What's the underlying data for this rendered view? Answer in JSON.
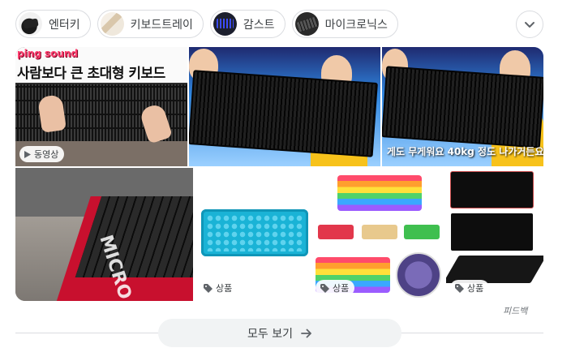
{
  "chips": [
    {
      "label": "엔터키",
      "thumb_icon": "keyboard-black-thumb"
    },
    {
      "label": "키보드트레이",
      "thumb_icon": "keyboard-tray-thumb"
    },
    {
      "label": "감스트",
      "thumb_icon": "keyboard-rgb-thumb"
    },
    {
      "label": "마이크로닉스",
      "thumb_icon": "micronics-keyboard-thumb"
    }
  ],
  "tiles": {
    "t1": {
      "overlay_pink": "ping sound",
      "overlay_big": "사람보다 큰 초대형 키보드",
      "badge": "동영상"
    },
    "t3": {
      "subtitle": "게도 무게워요 40kg 정도 나가거든요"
    },
    "t4": {
      "brand": "MICRO"
    },
    "t5": {
      "badge": "상품"
    },
    "t6": {
      "badge": "상품"
    },
    "t7": {
      "badge": "상품"
    }
  },
  "feedback": "피드백",
  "see_all": {
    "label": "모두 보기"
  },
  "colors": {
    "chip_border": "#dadce0",
    "see_all_bg": "#f1f3f4",
    "pink_text": "#ff3d6e"
  }
}
